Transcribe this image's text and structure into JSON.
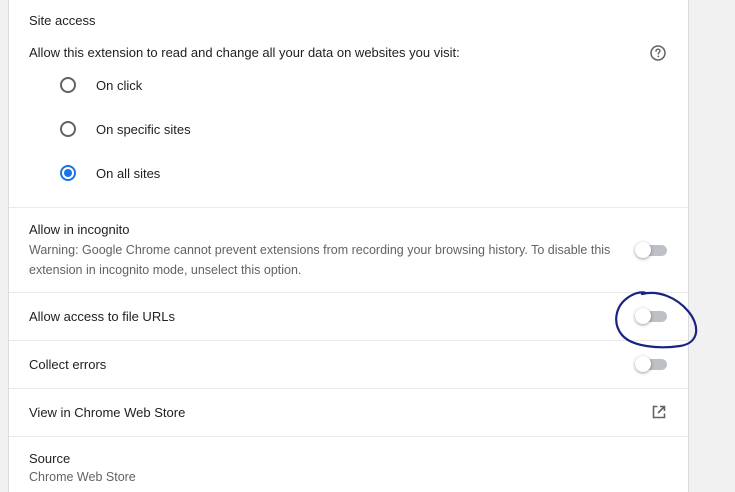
{
  "site_access": {
    "title": "Site access",
    "description": "Allow this extension to read and change all your data on websites you visit:",
    "help_icon": "help-circle-icon",
    "options": [
      {
        "label": "On click",
        "checked": false
      },
      {
        "label": "On specific sites",
        "checked": false
      },
      {
        "label": "On all sites",
        "checked": true
      }
    ]
  },
  "incognito": {
    "title": "Allow in incognito",
    "warning": "Warning: Google Chrome cannot prevent extensions from recording your browsing history. To disable this extension in incognito mode, unselect this option.",
    "enabled": false
  },
  "file_urls": {
    "title": "Allow access to file URLs",
    "enabled": false
  },
  "collect_errors": {
    "title": "Collect errors",
    "enabled": false
  },
  "web_store": {
    "label": "View in Chrome Web Store",
    "icon": "open-in-new-icon"
  },
  "source": {
    "title": "Source",
    "value": "Chrome Web Store"
  },
  "colors": {
    "accent": "#1a73e8",
    "annotation": "#1a237e",
    "toggle_off": "#bdc1c6"
  }
}
